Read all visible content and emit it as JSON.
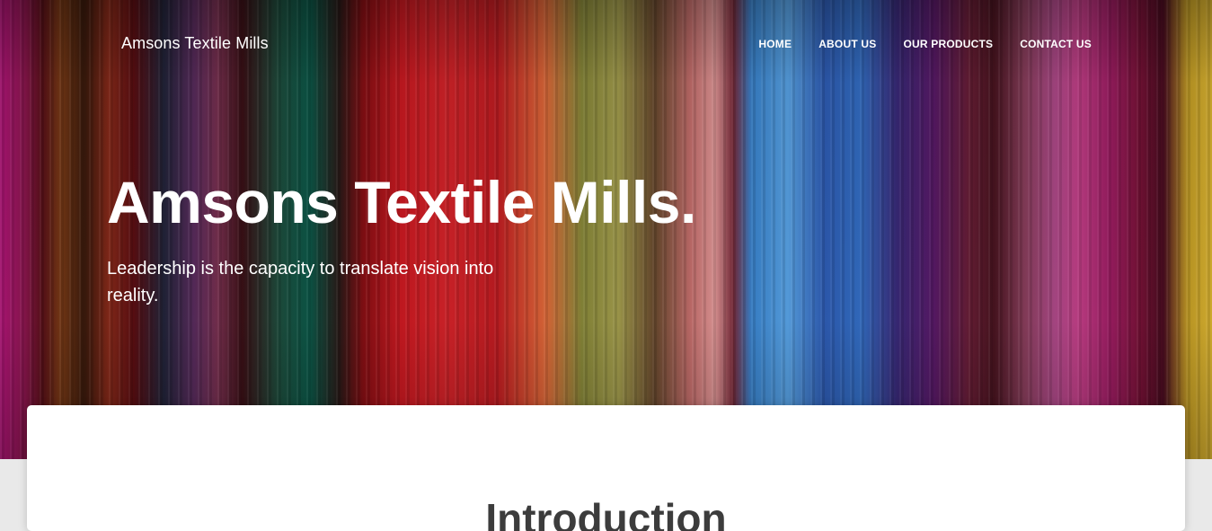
{
  "header": {
    "brand": "Amsons Textile Mills",
    "nav": [
      {
        "label": "HOME"
      },
      {
        "label": "ABOUT US"
      },
      {
        "label": "OUR PRODUCTS"
      },
      {
        "label": "CONTACT US"
      }
    ]
  },
  "hero": {
    "title": "Amsons Textile Mills.",
    "subtitle": "Leadership is the capacity to translate vision into reality."
  },
  "card": {
    "heading": "Introduction"
  }
}
